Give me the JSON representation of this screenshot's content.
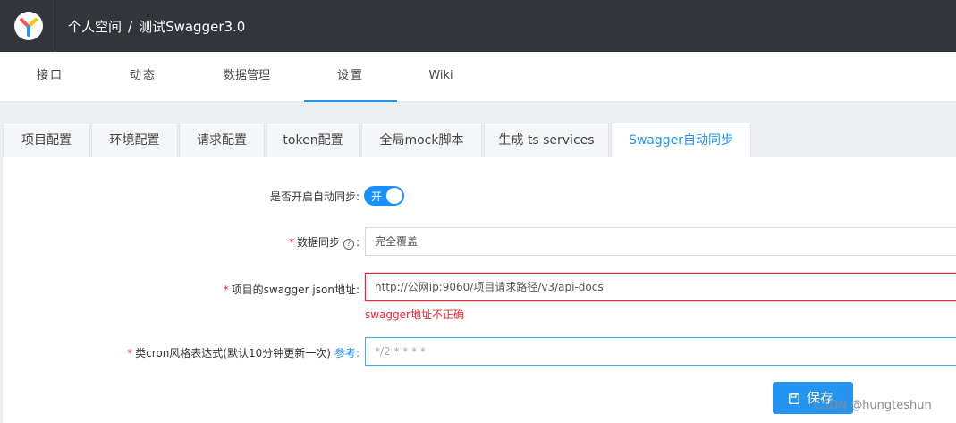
{
  "header": {
    "breadcrumb": [
      "个人空间",
      "测试Swagger3.0"
    ],
    "separator": "/"
  },
  "nav": {
    "items": [
      {
        "label": "接口",
        "active": false
      },
      {
        "label": "动态",
        "active": false
      },
      {
        "label": "数据管理",
        "active": false
      },
      {
        "label": "设置",
        "active": true
      },
      {
        "label": "Wiki",
        "active": false
      }
    ]
  },
  "tabs": [
    {
      "label": "项目配置",
      "active": false
    },
    {
      "label": "环境配置",
      "active": false
    },
    {
      "label": "请求配置",
      "active": false
    },
    {
      "label": "token配置",
      "active": false
    },
    {
      "label": "全局mock脚本",
      "active": false
    },
    {
      "label": "生成 ts services",
      "active": false
    },
    {
      "label": "Swagger自动同步",
      "active": true
    }
  ],
  "form": {
    "auto_sync": {
      "label": "是否开启自动同步:",
      "switch_text": "开",
      "enabled": true
    },
    "data_sync": {
      "required_mark": "*",
      "label": "数据同步",
      "help": "?",
      "suffix": ":",
      "value": "完全覆盖"
    },
    "swagger_url": {
      "required_mark": "*",
      "label": "项目的swagger json地址:",
      "value": "http://公网ip:9060/项目请求路径/v3/api-docs",
      "error": "swagger地址不正确"
    },
    "cron": {
      "required_mark": "*",
      "label": "类cron风格表达式(默认10分钟更新一次)",
      "ref_link": "参考:",
      "placeholder": "*/2 * * * *"
    }
  },
  "actions": {
    "save_label": "保存"
  },
  "watermark": "CSDN @hungteshun",
  "colors": {
    "accent": "#2395f1",
    "error": "#f5222d",
    "topbar": "#32363a"
  }
}
